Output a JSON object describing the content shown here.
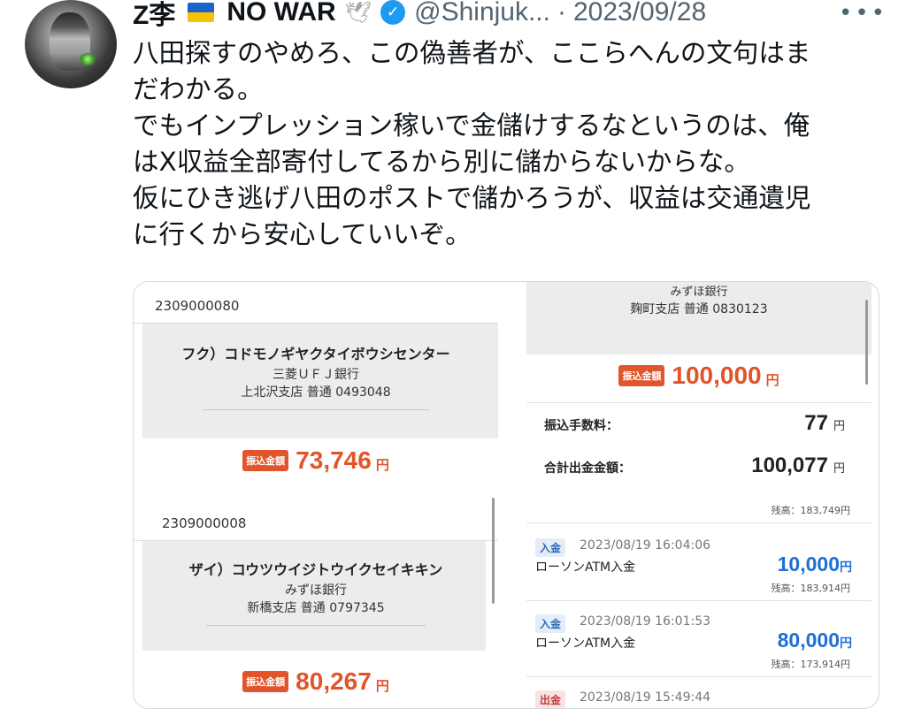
{
  "tweet": {
    "display_name": "Z李",
    "no_war": "NO WAR",
    "handle": "@Shinjuk...",
    "date_sep": "·",
    "date": "2023/09/28",
    "more": "•••",
    "lines": [
      "八田探すのやめろ、この偽善者が、ここらへんの文句はま",
      "だわかる。",
      "でもインプレッション稼いで金儲けするなというのは、俺",
      "はX収益全部寄付してるから別に儲からないからな。",
      "仮にひき逃げ八田のポストで儲かろうが、収益は交通遺児",
      "に行くから安心していいぞ。"
    ]
  },
  "icons": {
    "flag": "ukraine-flag-icon",
    "dove": "dove-icon",
    "verified": "verified-badge-icon",
    "more": "more-options-icon"
  },
  "colors": {
    "accent_orange": "#e2542a",
    "deposit_blue": "#1f6fd6",
    "verified_blue": "#1d9bf0"
  },
  "receipt1": {
    "account": "2309000080",
    "payee": "フク）コドモノギヤクタイボウシセンター",
    "bank": "三菱ＵＦＪ銀行",
    "branch": "上北沢支店 普通 0493048",
    "tag": "振込金額",
    "amount": "73,746",
    "yen": "円"
  },
  "receipt2": {
    "bank": "みずほ銀行",
    "branch": "麹町支店 普通 0830123",
    "tag": "振込金額",
    "amount": "100,000",
    "yen": "円",
    "fee_label": "振込手数料：",
    "fee": "77",
    "total_label": "合計出金金額：",
    "total": "100,077"
  },
  "receipt3": {
    "account": "2309000008",
    "payee": "ザイ）コウツウイジトウイクセイキキン",
    "bank": "みずほ銀行",
    "branch": "新橋支店 普通 0797345",
    "tag": "振込金額",
    "amount": "80,267",
    "yen": "円"
  },
  "history": {
    "top_balance": "残高：183,749円",
    "transactions": [
      {
        "type": "入金",
        "time": "2023/08/19 16:04:06",
        "desc": "ローソンATM入金",
        "amount": "10,000",
        "yen": "円",
        "balance": "残高：183,914円"
      },
      {
        "type": "入金",
        "time": "2023/08/19 16:01:53",
        "desc": "ローソンATM入金",
        "amount": "80,000",
        "yen": "円",
        "balance": "残高：173,914円"
      },
      {
        "type": "出金",
        "time": "2023/08/19 15:49:44"
      }
    ]
  }
}
